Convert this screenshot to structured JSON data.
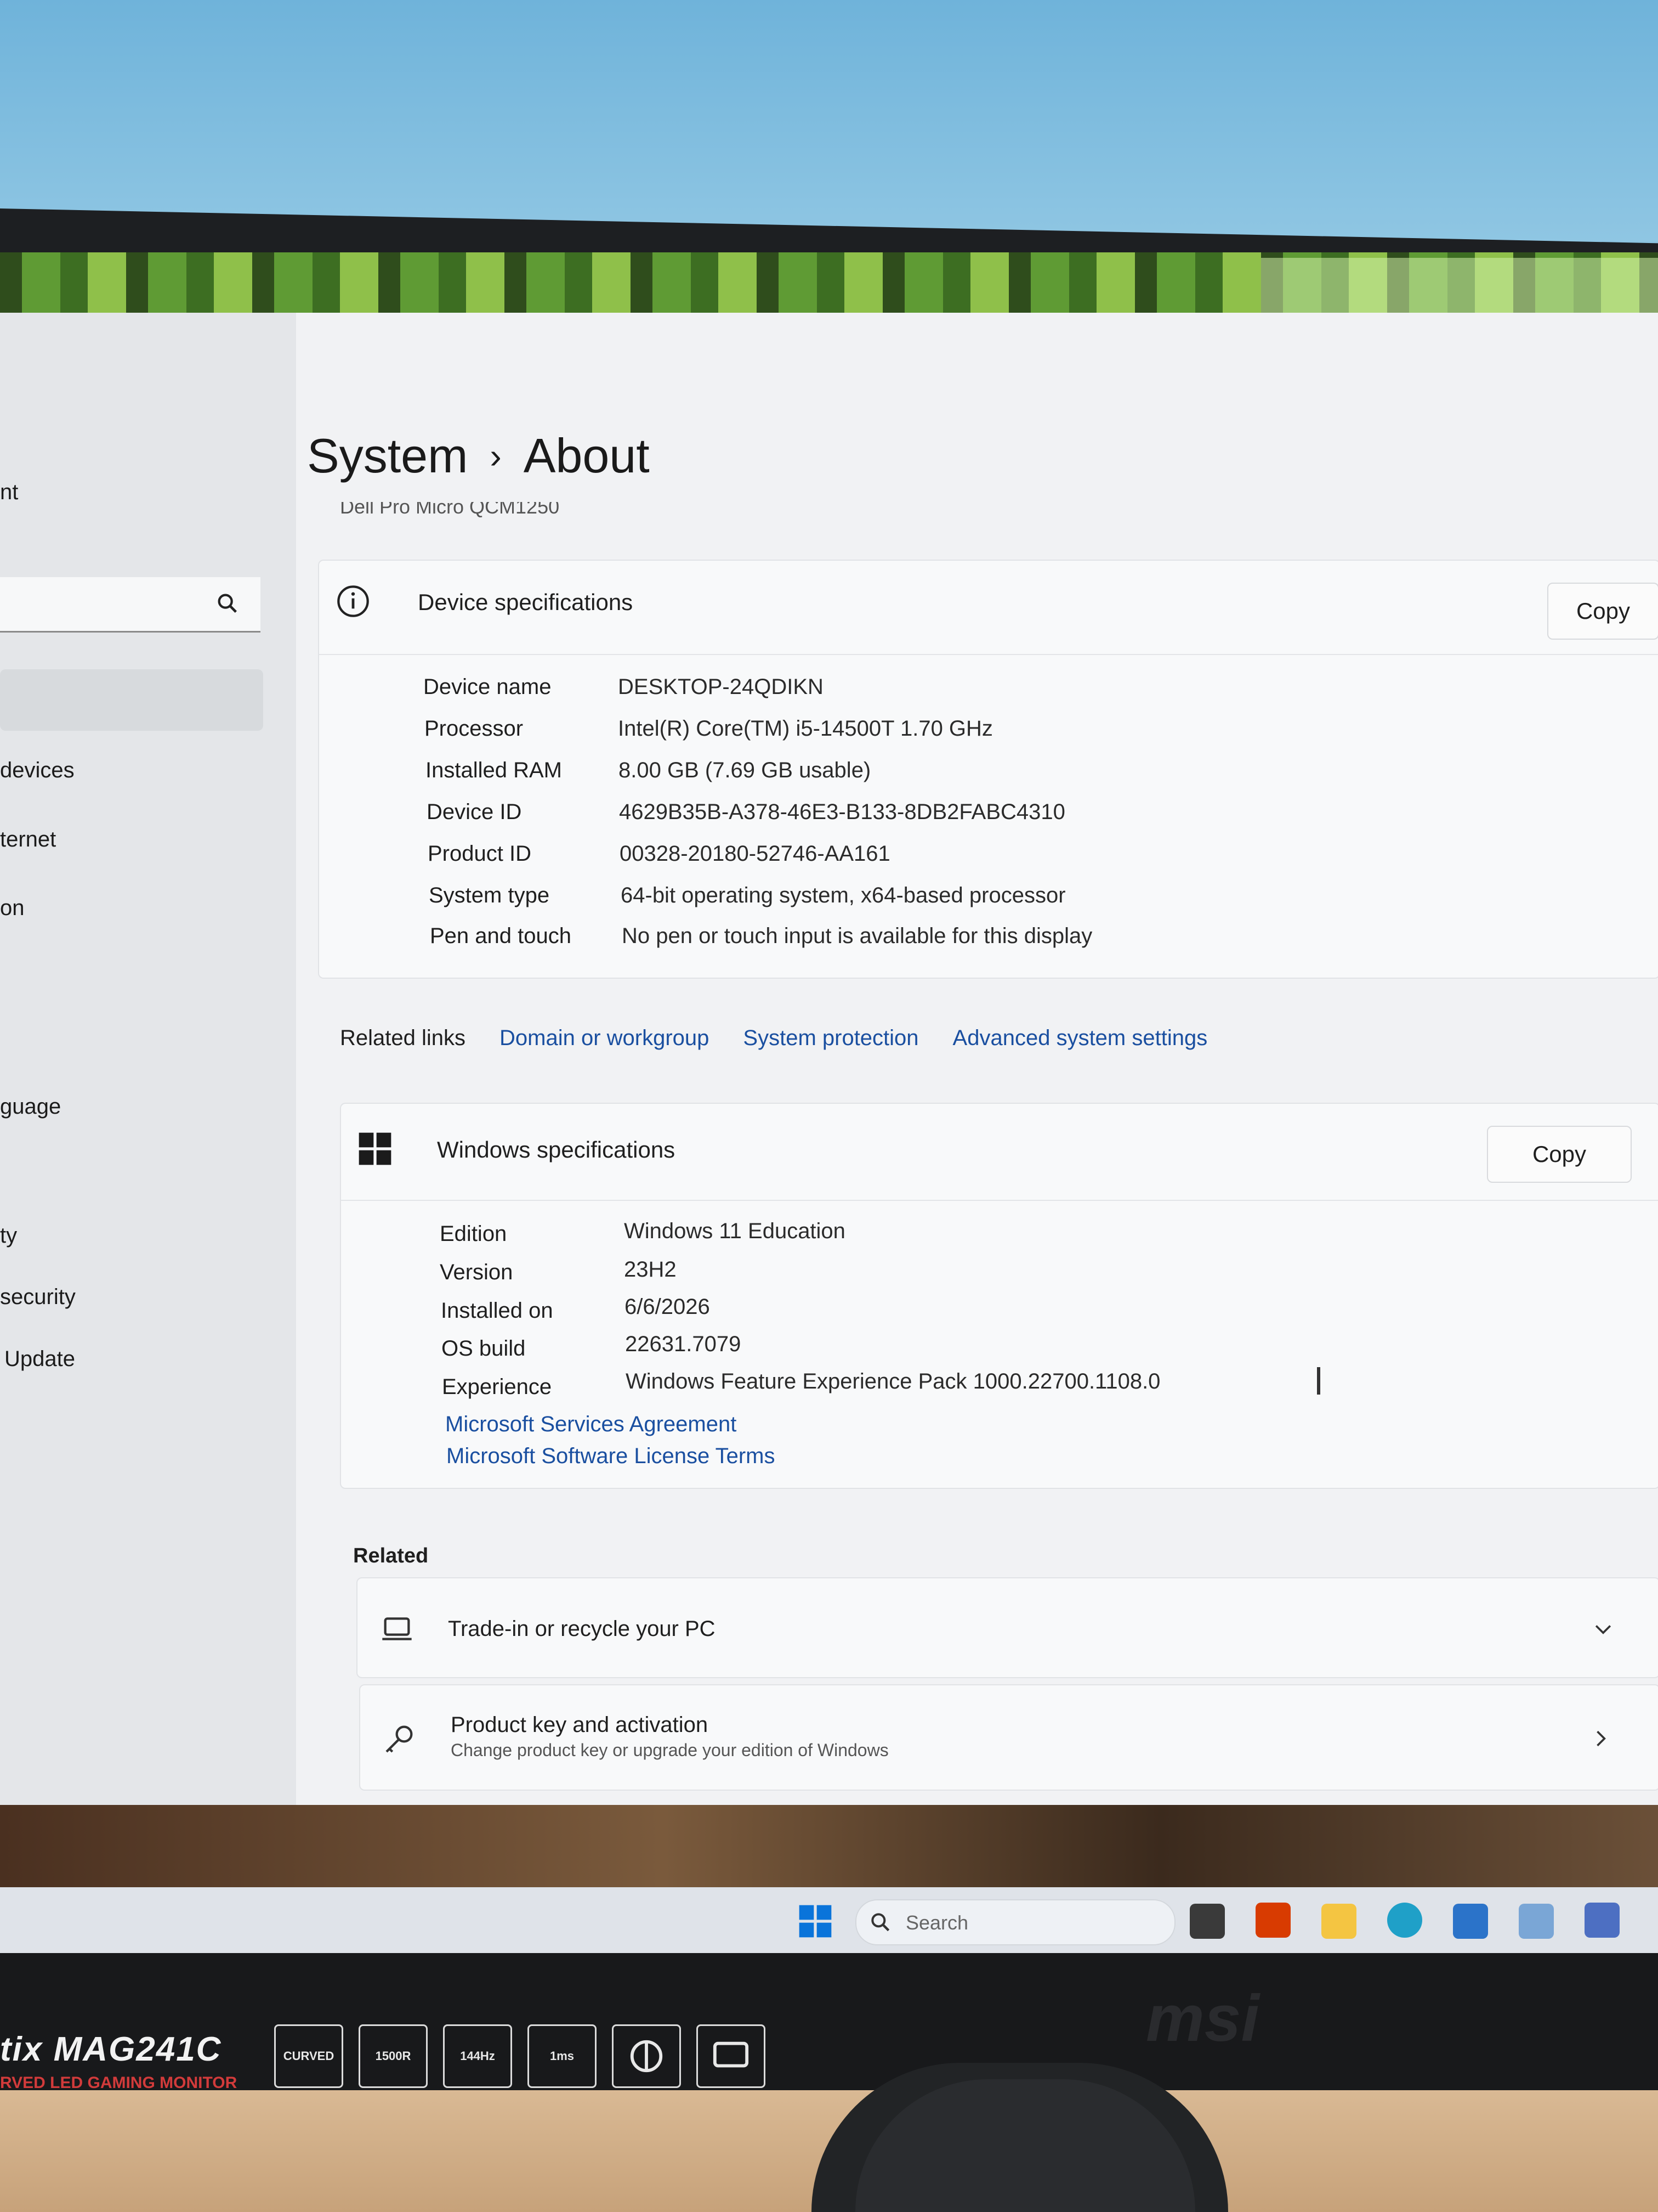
{
  "breadcrumb": {
    "parent": "System",
    "separator": "›",
    "current": "About"
  },
  "device_name_header": "Dell Pro Micro QCM1250",
  "sidebar": {
    "partial_top": "nt",
    "search_placeholder": "",
    "items": [
      {
        "label": "devices"
      },
      {
        "label": "ternet"
      },
      {
        "label": "on"
      },
      {
        "label": "guage"
      },
      {
        "label": "ty"
      },
      {
        "label": "security"
      },
      {
        "label": "Update"
      }
    ]
  },
  "device_specs": {
    "title": "Device specifications",
    "copy_label": "Copy",
    "rows": [
      {
        "label": "Device name",
        "value": "DESKTOP-24QDIKN"
      },
      {
        "label": "Processor",
        "value": "Intel(R) Core(TM) i5-14500T   1.70 GHz"
      },
      {
        "label": "Installed RAM",
        "value": "8.00 GB (7.69 GB usable)"
      },
      {
        "label": "Device ID",
        "value": "4629B35B-A378-46E3-B133-8DB2FABC4310"
      },
      {
        "label": "Product ID",
        "value": "00328-20180-52746-AA161"
      },
      {
        "label": "System type",
        "value": "64-bit operating system, x64-based processor"
      },
      {
        "label": "Pen and touch",
        "value": "No pen or touch input is available for this display"
      }
    ]
  },
  "related_links": {
    "label": "Related links",
    "links": [
      "Domain or workgroup",
      "System protection",
      "Advanced system settings"
    ]
  },
  "windows_specs": {
    "title": "Windows specifications",
    "copy_label": "Copy",
    "rows": [
      {
        "label": "Edition",
        "value": "Windows 11 Education"
      },
      {
        "label": "Version",
        "value": "23H2"
      },
      {
        "label": "Installed on",
        "value": "6/6/2026"
      },
      {
        "label": "OS build",
        "value": "22631.7079"
      },
      {
        "label": "Experience",
        "value": "Windows Feature Experience Pack 1000.22700.1108.0"
      }
    ],
    "links": [
      "Microsoft Services Agreement",
      "Microsoft Software License Terms"
    ]
  },
  "related": {
    "heading": "Related",
    "items": [
      {
        "title": "Trade-in or recycle your PC",
        "subtitle": "",
        "icon": "laptop-icon",
        "chevron": "chevron-down-icon"
      },
      {
        "title": "Product key and activation",
        "subtitle": "Change product key or upgrade your edition of Windows",
        "icon": "key-icon",
        "chevron": "chevron-right-icon"
      }
    ]
  },
  "taskbar": {
    "search_placeholder": "Search",
    "icons": [
      "start-icon",
      "search-icon",
      "task-view-icon",
      "office-icon",
      "file-explorer-icon",
      "edge-icon",
      "store-icon",
      "photos-icon",
      "app-icon"
    ]
  },
  "monitor": {
    "brand": "tix MAG241C",
    "subtitle": "RVED LED GAMING MONITOR",
    "logo": "msi",
    "badges": [
      "CURVED",
      "1500R",
      "144Hz",
      "1ms",
      "",
      ""
    ]
  },
  "colors": {
    "accent": "#1a4fa0",
    "windows_logo": "#1b1b1b",
    "taskbar_start": "#0a74da"
  }
}
